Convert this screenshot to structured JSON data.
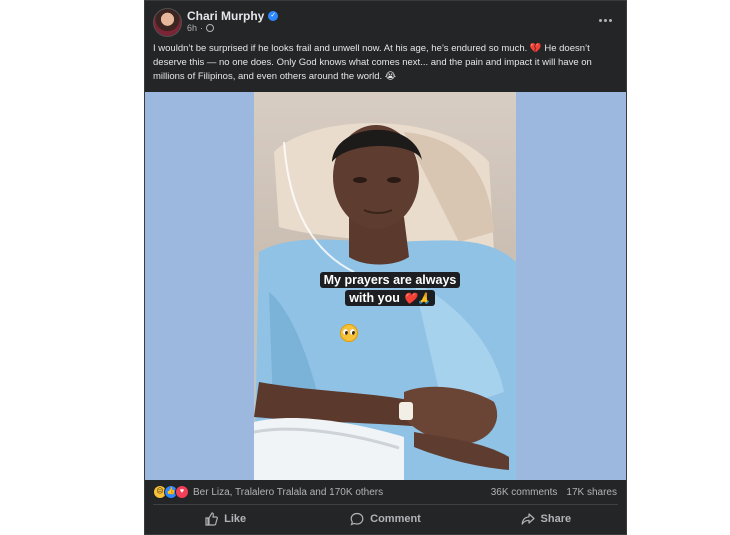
{
  "post": {
    "author": "Chari Murphy",
    "timestamp": "6h",
    "verified_icon": "verified-badge-icon",
    "privacy_icon": "globe-icon",
    "text": "I wouldn’t be surprised if he looks frail and unwell now. At his age, he’s endured so much. 💔 He doesn’t deserve this — no one does. Only God knows what comes next... and the pain and impact it will have on millions of Filipinos, and even others around the world. 😭"
  },
  "image": {
    "caption_line1": "My prayers are always",
    "caption_line2": "with you",
    "caption_emojis": [
      "❤️",
      "🙏"
    ],
    "sticker": "pleading-face-emoji"
  },
  "reactions": {
    "icons": [
      "sad-react-icon",
      "like-react-icon",
      "love-react-icon"
    ],
    "names": "Ber Liza, Tralalero Tralala and 170K others",
    "comments": "36K comments",
    "shares": "17K shares"
  },
  "actions": {
    "like": "Like",
    "comment": "Comment",
    "share": "Share"
  },
  "colors": {
    "card_bg": "#242526",
    "media_bg": "#9db8de",
    "text_primary": "#e4e6eb",
    "text_secondary": "#b0b3b8",
    "accent": "#2d88ff"
  }
}
